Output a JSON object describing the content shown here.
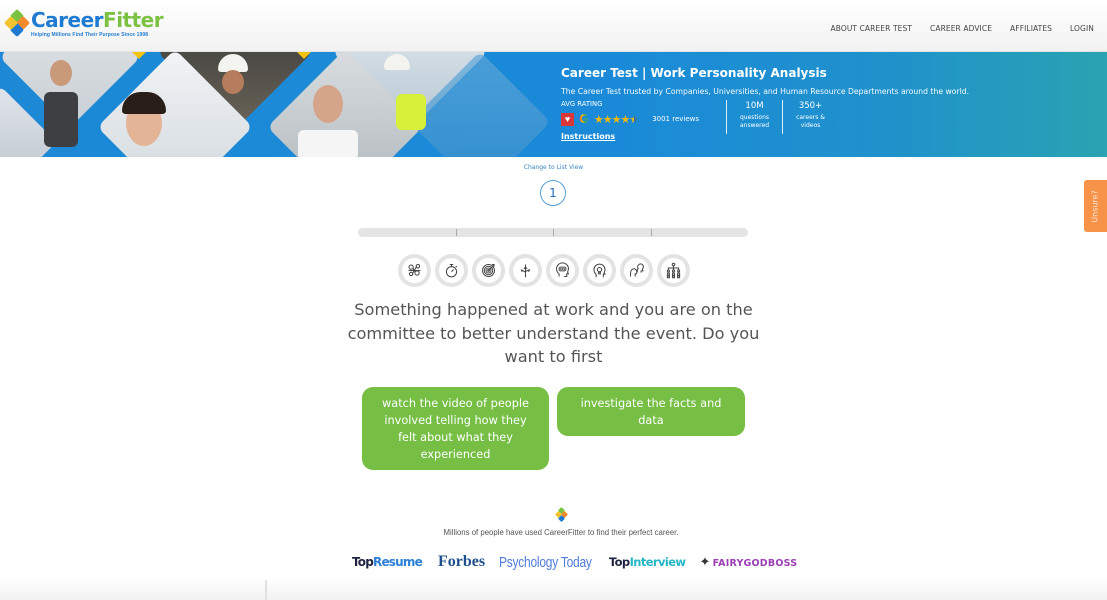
{
  "header": {
    "logo": {
      "word_part1": "Career",
      "word_part2": "Fitter",
      "tagline": "Helping Millions Find Their Purpose Since 1998"
    },
    "nav": [
      {
        "label": "ABOUT CAREER TEST"
      },
      {
        "label": "CAREER ADVICE"
      },
      {
        "label": "AFFILIATES"
      },
      {
        "label": "LOGIN"
      }
    ]
  },
  "banner": {
    "title": "Career Test | Work Personality Analysis",
    "subtitle": "The Career Test trusted by Companies, Universities, and Human Resource Departments around the world.",
    "rating": {
      "label": "AVG RATING",
      "heart_icon": "♥",
      "google_icon": "G",
      "stars_value": 4.5,
      "stars_max": 5,
      "stars_full": "★★★★",
      "star_partial": "★",
      "reviews": "3001 reviews"
    },
    "instructions_link": "Instructions",
    "stats": [
      {
        "number": "10M",
        "label_line1": "questions",
        "label_line2": "answered"
      },
      {
        "number": "350+",
        "label_line1": "careers &",
        "label_line2": "videos"
      }
    ],
    "accent_colors": {
      "banner_blue": "#1a8ad8",
      "star_gold": "#f5b90b"
    }
  },
  "side_tab": {
    "label": "Unsure?",
    "color": "#f79249"
  },
  "quiz": {
    "list_view_link": "Change to List View",
    "question_number": "1",
    "progress": {
      "fraction": 0.0,
      "segments": 4
    },
    "category_icons": [
      {
        "name": "gears-network-icon"
      },
      {
        "name": "stopwatch-icon"
      },
      {
        "name": "target-icon"
      },
      {
        "name": "crossroads-arrows-icon"
      },
      {
        "name": "head-chat-icon"
      },
      {
        "name": "head-lightbulb-icon"
      },
      {
        "name": "two-heads-dialogue-icon"
      },
      {
        "name": "org-chart-icon"
      }
    ],
    "question": "Something happened at work and you are on the committee to better understand the event. Do you want to first",
    "answers": [
      {
        "label": "watch the video of people involved telling how they felt about what they experienced"
      },
      {
        "label": "investigate the facts and data"
      }
    ],
    "answer_color": "#76bf44"
  },
  "trust": {
    "text": "Millions of people have used CareerFitter to find their perfect career.",
    "brands": [
      {
        "name": "TopResume",
        "part1": "Top",
        "part2": "Resume"
      },
      {
        "name": "Forbes",
        "text": "Forbes"
      },
      {
        "name": "Psychology Today",
        "text": "Psychology Today"
      },
      {
        "name": "TopInterview",
        "part1": "Top",
        "part2": "Interview"
      },
      {
        "name": "Fairygodboss",
        "text": "FAIRYGODBOSS"
      }
    ]
  }
}
